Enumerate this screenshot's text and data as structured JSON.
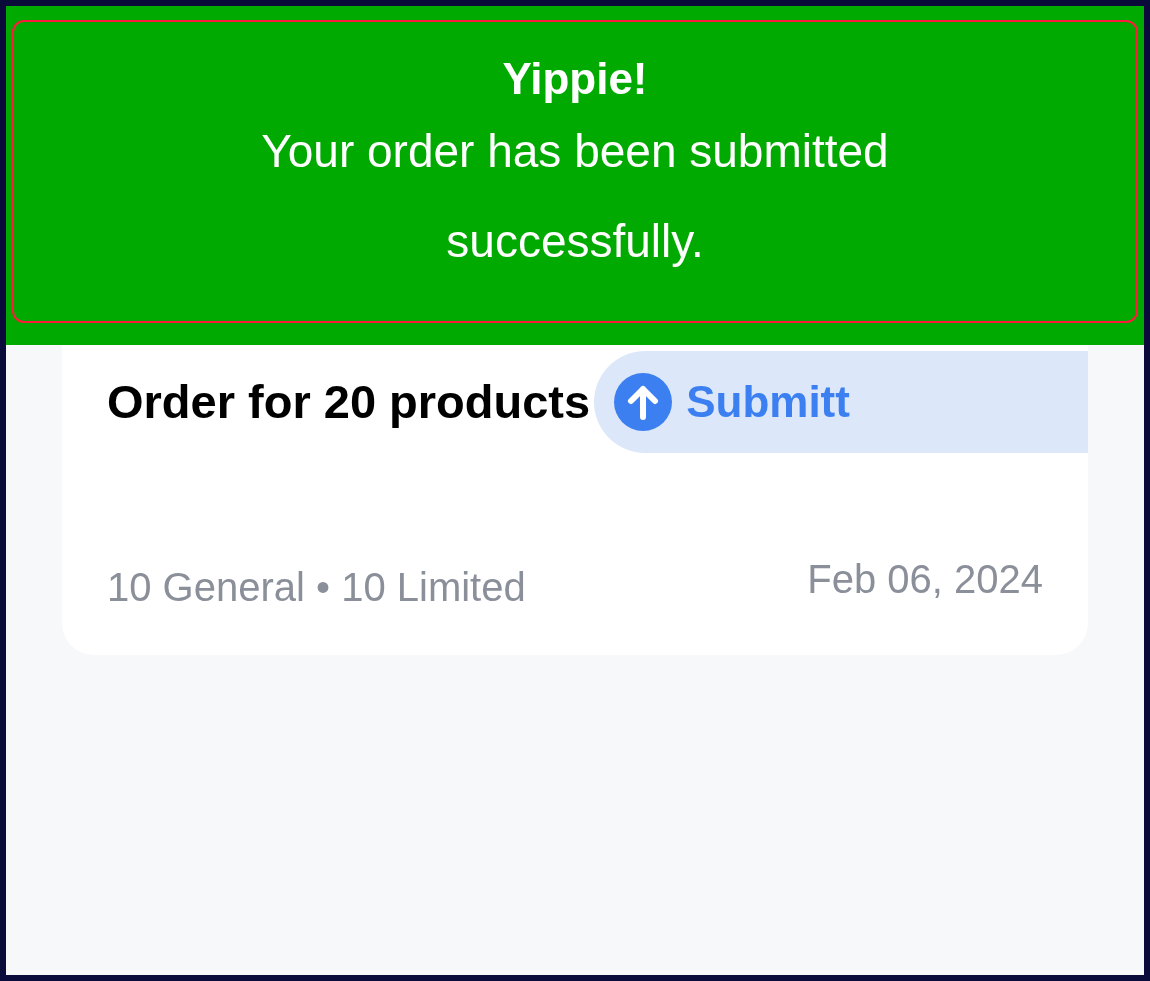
{
  "banner": {
    "title": "Yippie!",
    "message": "Your order has been submitted successfully."
  },
  "order_card": {
    "title": "Order for 20 products",
    "status": {
      "kind": "submitted",
      "label": "Submitt"
    },
    "summary": "10 General • 10 Limited",
    "date": "Feb 06, 2024"
  }
}
